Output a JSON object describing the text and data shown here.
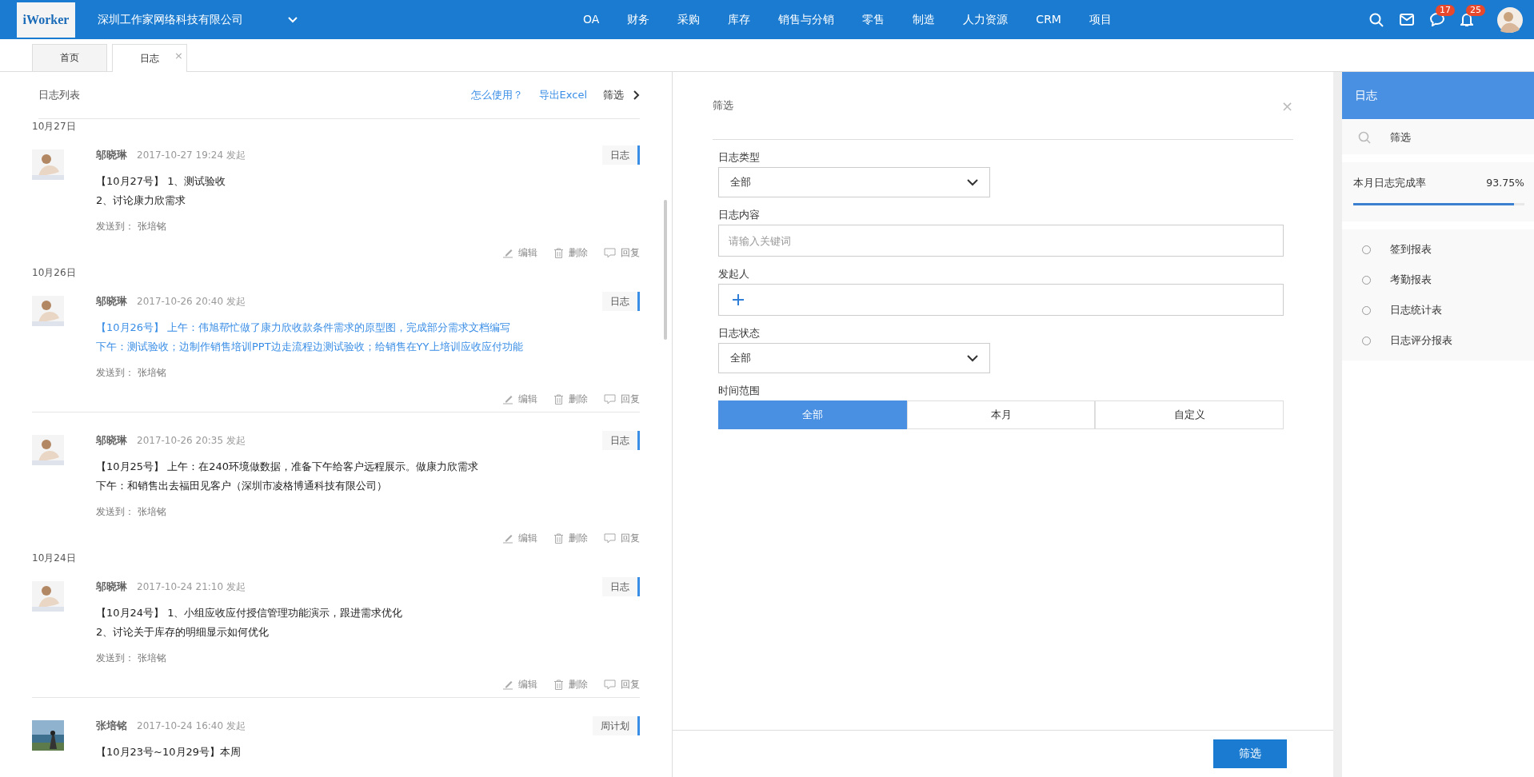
{
  "header": {
    "logo": "iWorker",
    "company": "深圳工作家网络科技有限公司",
    "nav": [
      "OA",
      "财务",
      "采购",
      "库存",
      "销售与分销",
      "零售",
      "制造",
      "人力资源",
      "CRM",
      "项目"
    ],
    "message_badge": "17",
    "notice_badge": "25"
  },
  "tabs": [
    {
      "label": "首页",
      "selected": false
    },
    {
      "label": "日志",
      "selected": true,
      "close": "×"
    }
  ],
  "log_list": {
    "title": "日志列表",
    "help_link": "怎么使用？",
    "export_link": "导出Excel",
    "filter_label": "筛选",
    "groups": [
      {
        "date": "10月27日",
        "entries": [
          {
            "author": "邬晓琳",
            "time": "2017-10-27 19:24 发起",
            "tag": "日志",
            "highlighted": false,
            "lines": [
              "【10月27号】 1、测试验收",
              "2、讨论康力欣需求"
            ],
            "send_to": "发送到：  张培铭",
            "actions": [
              "编辑",
              "删除",
              "回复"
            ]
          }
        ]
      },
      {
        "date": "10月26日",
        "entries": [
          {
            "author": "邬晓琳",
            "time": "2017-10-26 20:40 发起",
            "tag": "日志",
            "highlighted": true,
            "lines": [
              "【10月26号】 上午：伟旭帮忙做了康力欣收款条件需求的原型图，完成部分需求文档编写",
              "下午：测试验收；边制作销售培训PPT边走流程边测试验收；给销售在YY上培训应收应付功能"
            ],
            "send_to": "发送到：  张培铭",
            "actions": [
              "编辑",
              "删除",
              "回复"
            ]
          },
          {
            "author": "邬晓琳",
            "time": "2017-10-26 20:35 发起",
            "tag": "日志",
            "highlighted": false,
            "lines": [
              "【10月25号】 上午：在240环境做数据，准备下午给客户远程展示。做康力欣需求",
              "下午：和销售出去福田见客户（深圳市凌格博通科技有限公司）"
            ],
            "send_to": "发送到：  张培铭",
            "actions": [
              "编辑",
              "删除",
              "回复"
            ]
          }
        ]
      },
      {
        "date": "10月24日",
        "entries": [
          {
            "author": "邬晓琳",
            "time": "2017-10-24 21:10 发起",
            "tag": "日志",
            "highlighted": false,
            "lines": [
              "【10月24号】 1、小组应收应付授信管理功能演示，跟进需求优化",
              "2、讨论关于库存的明细显示如何优化"
            ],
            "send_to": "发送到：  张培铭",
            "actions": [
              "编辑",
              "删除",
              "回复"
            ]
          },
          {
            "author": "张培铭",
            "time": "2017-10-24 16:40 发起",
            "tag": "周计划",
            "highlighted": false,
            "lines": [
              "【10月23号~10月29号】本周"
            ]
          }
        ]
      }
    ]
  },
  "filter": {
    "title": "筛选",
    "close": "×",
    "fields": [
      {
        "kind": "select",
        "label": "日志类型",
        "value": "全部"
      },
      {
        "kind": "text",
        "label": "日志内容",
        "placeholder": "请输入关键词"
      },
      {
        "kind": "adder",
        "label": "发起人"
      },
      {
        "kind": "select",
        "label": "日志状态",
        "value": "全部"
      },
      {
        "kind": "segmented",
        "label": "时间范围",
        "options": [
          {
            "label": "全部",
            "selected": true
          },
          {
            "label": "本月",
            "selected": false
          },
          {
            "label": "自定义",
            "selected": false
          }
        ]
      }
    ],
    "submit": "筛选"
  },
  "sidebar": {
    "title": "日志",
    "search_label": "筛选",
    "rate_label": "本月日志完成率",
    "rate_value": "93.75%",
    "level": 0.9375,
    "reports": [
      {
        "label": "签到报表",
        "selected": false
      },
      {
        "label": "考勤报表",
        "selected": false
      },
      {
        "label": "日志统计表",
        "selected": false
      },
      {
        "label": "日志评分报表",
        "selected": false
      }
    ]
  }
}
